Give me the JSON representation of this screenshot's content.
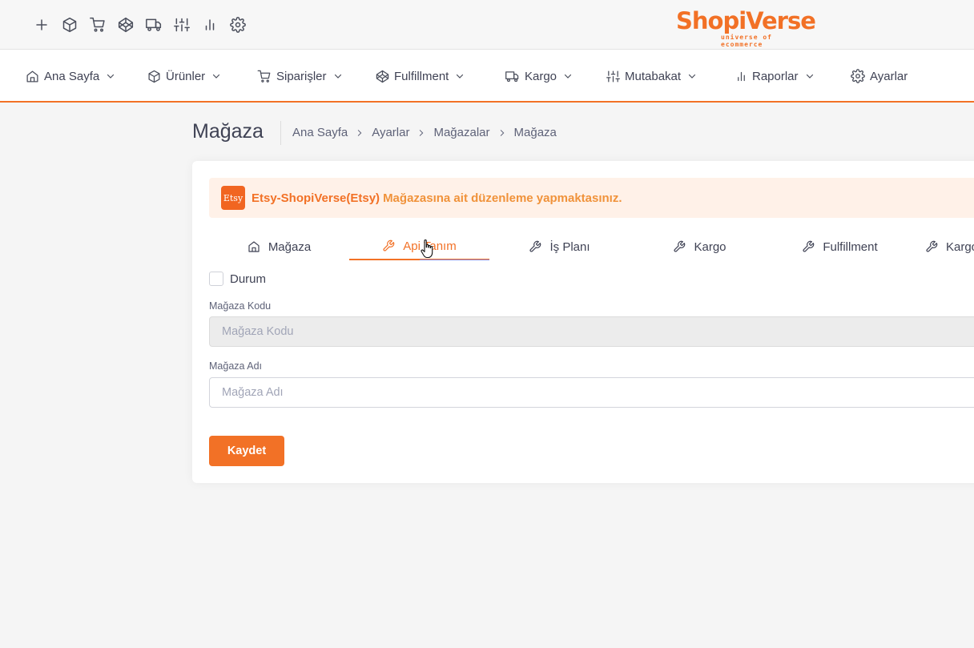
{
  "brand": {
    "name": "ShopiVerse",
    "tagline": "universe of ecommerce",
    "color": "#f27126"
  },
  "quick_icons": [
    "plus-icon",
    "box-icon",
    "cart-icon",
    "codepen-icon",
    "truck-icon",
    "sliders-icon",
    "bar-chart-icon",
    "gear-icon"
  ],
  "nav": {
    "items": [
      {
        "label": "Ana Sayfa",
        "icon": "home-icon",
        "dropdown": true
      },
      {
        "label": "Ürünler",
        "icon": "box-icon",
        "dropdown": true
      },
      {
        "label": "Siparişler",
        "icon": "cart-icon",
        "dropdown": true
      },
      {
        "label": "Fulfillment",
        "icon": "codepen-icon",
        "dropdown": true
      },
      {
        "label": "Kargo",
        "icon": "truck-icon",
        "dropdown": true
      },
      {
        "label": "Mutabakat",
        "icon": "sliders-icon",
        "dropdown": true
      },
      {
        "label": "Raporlar",
        "icon": "bar-chart-icon",
        "dropdown": true
      },
      {
        "label": "Ayarlar",
        "icon": "gear-icon",
        "dropdown": false
      }
    ]
  },
  "page": {
    "title": "Mağaza",
    "breadcrumb": [
      "Ana Sayfa",
      "Ayarlar",
      "Mağazalar",
      "Mağaza"
    ]
  },
  "notice": {
    "badge": "Etsy",
    "store": "Etsy-ShopiVerse(Etsy)",
    "message": "Mağazasına ait düzenleme yapmaktasınız."
  },
  "tabs": [
    {
      "label": "Mağaza",
      "icon": "home-icon",
      "active": false
    },
    {
      "label": "Api Tanım",
      "icon": "wrench-icon",
      "active": true
    },
    {
      "label": "İş Planı",
      "icon": "wrench-icon",
      "active": false
    },
    {
      "label": "Kargo",
      "icon": "wrench-icon",
      "active": false
    },
    {
      "label": "Fulfillment",
      "icon": "wrench-icon",
      "active": false
    },
    {
      "label": "Kargo",
      "icon": "wrench-icon",
      "active": false
    }
  ],
  "form": {
    "status_label": "Durum",
    "status_checked": false,
    "store_code_label": "Mağaza Kodu",
    "store_code_placeholder": "Mağaza Kodu",
    "store_code_value": "",
    "store_name_label": "Mağaza Adı",
    "store_name_placeholder": "Mağaza Adı",
    "store_name_value": "",
    "save_label": "Kaydet"
  }
}
